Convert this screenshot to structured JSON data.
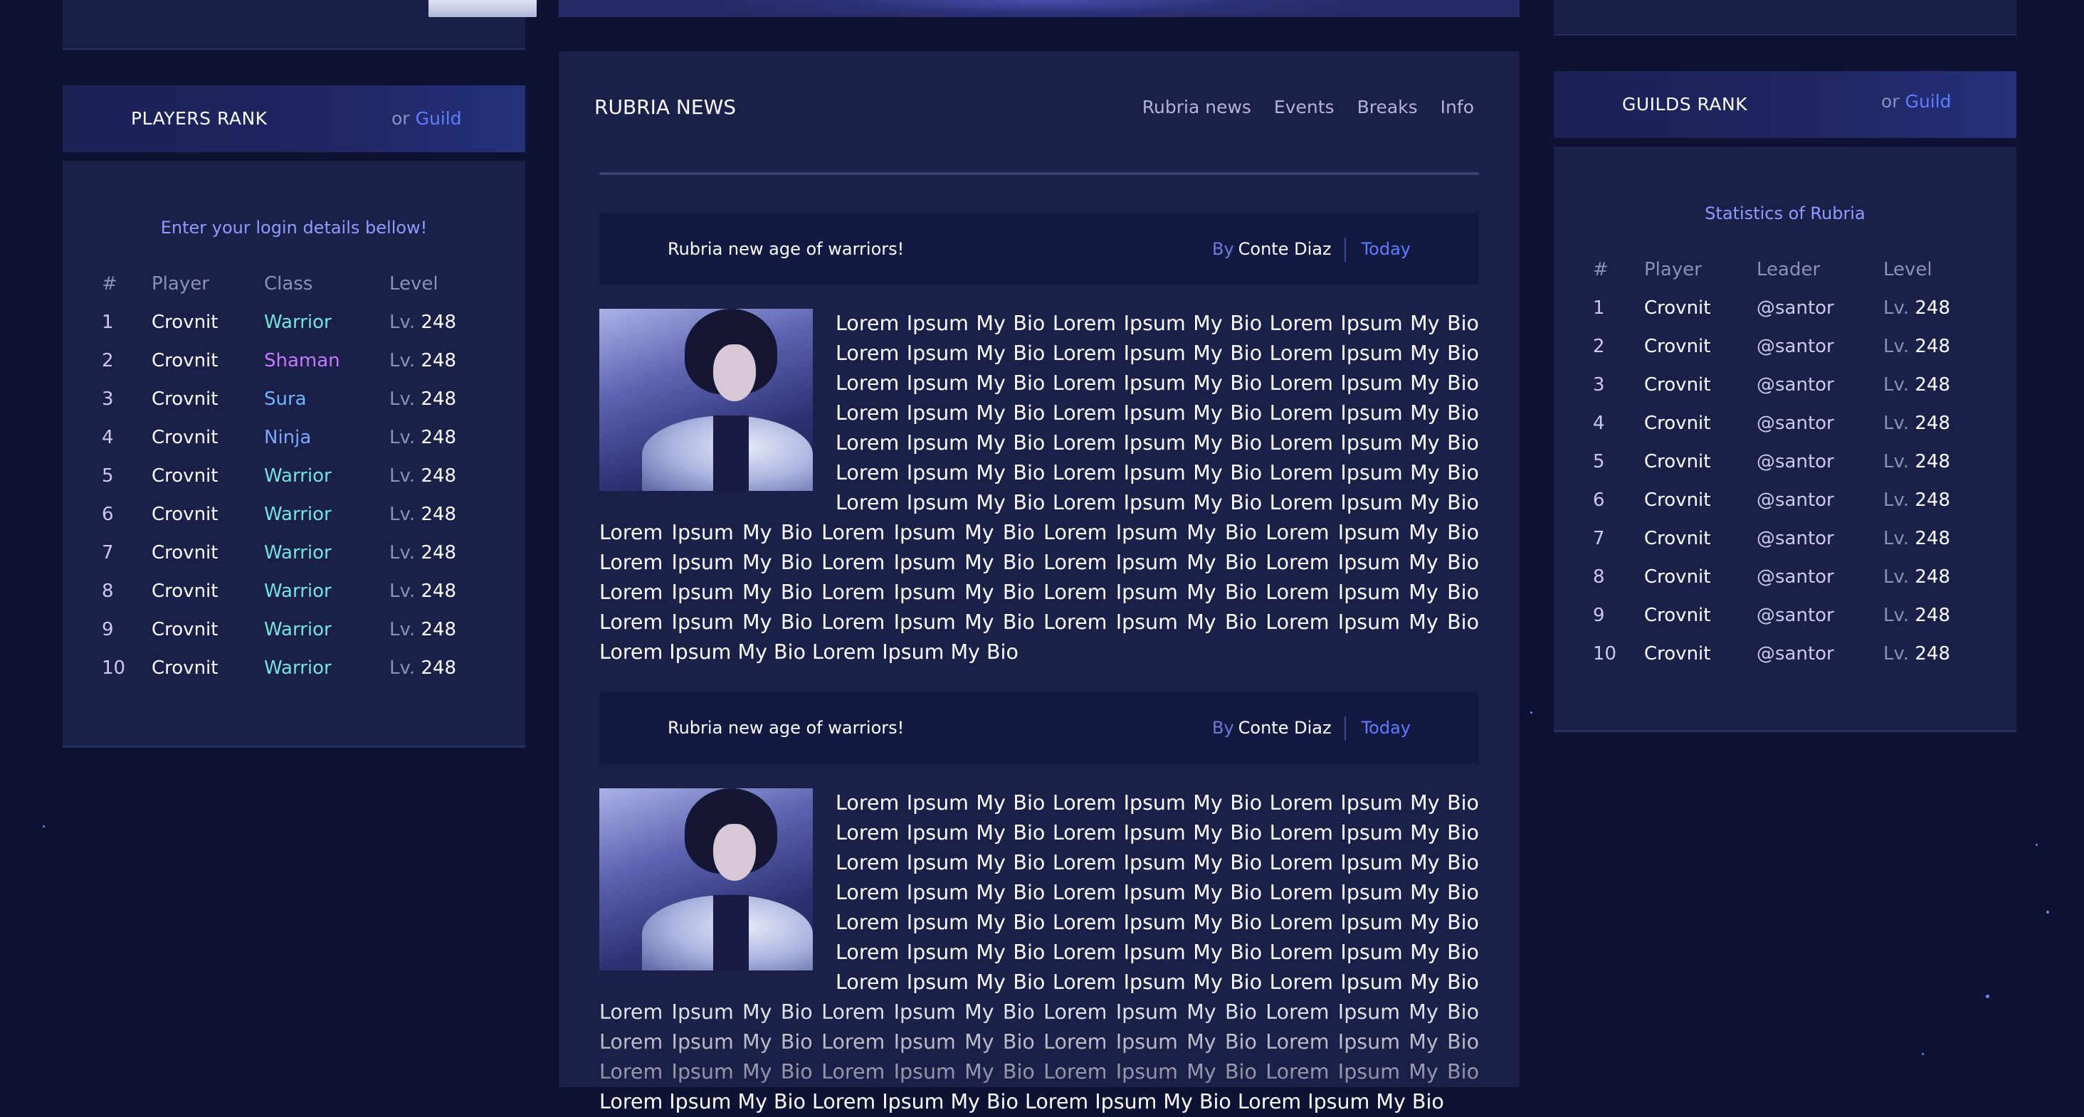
{
  "players_rank": {
    "title": "PLAYERS RANK",
    "or_label": "or",
    "guild_link": "Guild",
    "intro": "Enter your login details bellow!",
    "columns": [
      "#",
      "Player",
      "Class",
      "Level"
    ],
    "level_prefix": "Lv.",
    "rows": [
      {
        "rank": "1",
        "player": "Crovnit",
        "class": "Warrior",
        "level": "248"
      },
      {
        "rank": "2",
        "player": "Crovnit",
        "class": "Shaman",
        "level": "248"
      },
      {
        "rank": "3",
        "player": "Crovnit",
        "class": "Sura",
        "level": "248"
      },
      {
        "rank": "4",
        "player": "Crovnit",
        "class": "Ninja",
        "level": "248"
      },
      {
        "rank": "5",
        "player": "Crovnit",
        "class": "Warrior",
        "level": "248"
      },
      {
        "rank": "6",
        "player": "Crovnit",
        "class": "Warrior",
        "level": "248"
      },
      {
        "rank": "7",
        "player": "Crovnit",
        "class": "Warrior",
        "level": "248"
      },
      {
        "rank": "8",
        "player": "Crovnit",
        "class": "Warrior",
        "level": "248"
      },
      {
        "rank": "9",
        "player": "Crovnit",
        "class": "Warrior",
        "level": "248"
      },
      {
        "rank": "10",
        "player": "Crovnit",
        "class": "Warrior",
        "level": "248"
      }
    ]
  },
  "news": {
    "title": "RUBRIA NEWS",
    "nav": [
      "Rubria news",
      "Events",
      "Breaks",
      "Info"
    ],
    "articles": [
      {
        "title": "Rubria new age of warriors!",
        "by_label": "By",
        "author": "Conte Diaz",
        "date": "Today",
        "body": "Lorem Ipsum My Bio Lorem Ipsum My Bio Lorem Ipsum My Bio Lorem Ipsum My Bio Lorem Ipsum My Bio Lorem Ipsum My Bio Lorem Ipsum My Bio Lorem Ipsum My Bio Lorem Ipsum My Bio Lorem Ipsum My Bio Lorem Ipsum My Bio Lorem Ipsum My Bio Lorem Ipsum My Bio Lorem Ipsum My Bio Lorem Ipsum My Bio Lorem Ipsum My Bio Lorem Ipsum My Bio Lorem Ipsum My Bio Lorem Ipsum My Bio Lorem Ipsum My Bio Lorem Ipsum My Bio Lorem Ipsum My Bio Lorem Ipsum My Bio Lorem Ipsum My Bio Lorem Ipsum My Bio Lorem Ipsum My Bio Lorem Ipsum My Bio Lorem Ipsum My Bio Lorem Ipsum My Bio Lorem Ipsum My Bio Lorem Ipsum My Bio Lorem Ipsum My Bio Lorem Ipsum My Bio Lorem Ipsum My Bio Lorem Ipsum My Bio Lorem Ipsum My Bio Lorem Ipsum My Bio Lorem Ipsum My Bio Lorem Ipsum My Bio"
      },
      {
        "title": "Rubria new age of warriors!",
        "by_label": "By",
        "author": "Conte Diaz",
        "date": "Today",
        "body": "Lorem Ipsum My Bio Lorem Ipsum My Bio Lorem Ipsum My Bio Lorem Ipsum My Bio Lorem Ipsum My Bio Lorem Ipsum My Bio Lorem Ipsum My Bio Lorem Ipsum My Bio Lorem Ipsum My Bio Lorem Ipsum My Bio Lorem Ipsum My Bio Lorem Ipsum My Bio Lorem Ipsum My Bio Lorem Ipsum My Bio Lorem Ipsum My Bio Lorem Ipsum My Bio Lorem Ipsum My Bio Lorem Ipsum My Bio Lorem Ipsum My Bio Lorem Ipsum My Bio Lorem Ipsum My Bio Lorem Ipsum My Bio Lorem Ipsum My Bio Lorem Ipsum My Bio Lorem Ipsum My Bio Lorem Ipsum My Bio Lorem Ipsum My Bio Lorem Ipsum My Bio Lorem Ipsum My Bio Lorem Ipsum My Bio Lorem Ipsum My Bio Lorem Ipsum My Bio Lorem Ipsum My Bio Lorem Ipsum My Bio Lorem Ipsum My Bio Lorem Ipsum My Bio Lorem Ipsum My Bio"
      }
    ]
  },
  "guilds_rank": {
    "title": "GUILDS RANK",
    "or_label": "or",
    "guild_link": "Guild",
    "intro": "Statistics of Rubria",
    "columns": [
      "#",
      "Player",
      "Leader",
      "Level"
    ],
    "level_prefix": "Lv.",
    "rows": [
      {
        "rank": "1",
        "player": "Crovnit",
        "leader": "@santor",
        "level": "248"
      },
      {
        "rank": "2",
        "player": "Crovnit",
        "leader": "@santor",
        "level": "248"
      },
      {
        "rank": "3",
        "player": "Crovnit",
        "leader": "@santor",
        "level": "248"
      },
      {
        "rank": "4",
        "player": "Crovnit",
        "leader": "@santor",
        "level": "248"
      },
      {
        "rank": "5",
        "player": "Crovnit",
        "leader": "@santor",
        "level": "248"
      },
      {
        "rank": "6",
        "player": "Crovnit",
        "leader": "@santor",
        "level": "248"
      },
      {
        "rank": "7",
        "player": "Crovnit",
        "leader": "@santor",
        "level": "248"
      },
      {
        "rank": "8",
        "player": "Crovnit",
        "leader": "@santor",
        "level": "248"
      },
      {
        "rank": "9",
        "player": "Crovnit",
        "leader": "@santor",
        "level": "248"
      },
      {
        "rank": "10",
        "player": "Crovnit",
        "leader": "@santor",
        "level": "248"
      }
    ]
  },
  "colors": {
    "background": "#0e1233",
    "panel": "#1b2049",
    "accent": "#5f7cff",
    "warrior": "#74e4dd",
    "shaman": "#c478ff",
    "sura": "#6fb4ff",
    "ninja": "#7aa9ff"
  }
}
